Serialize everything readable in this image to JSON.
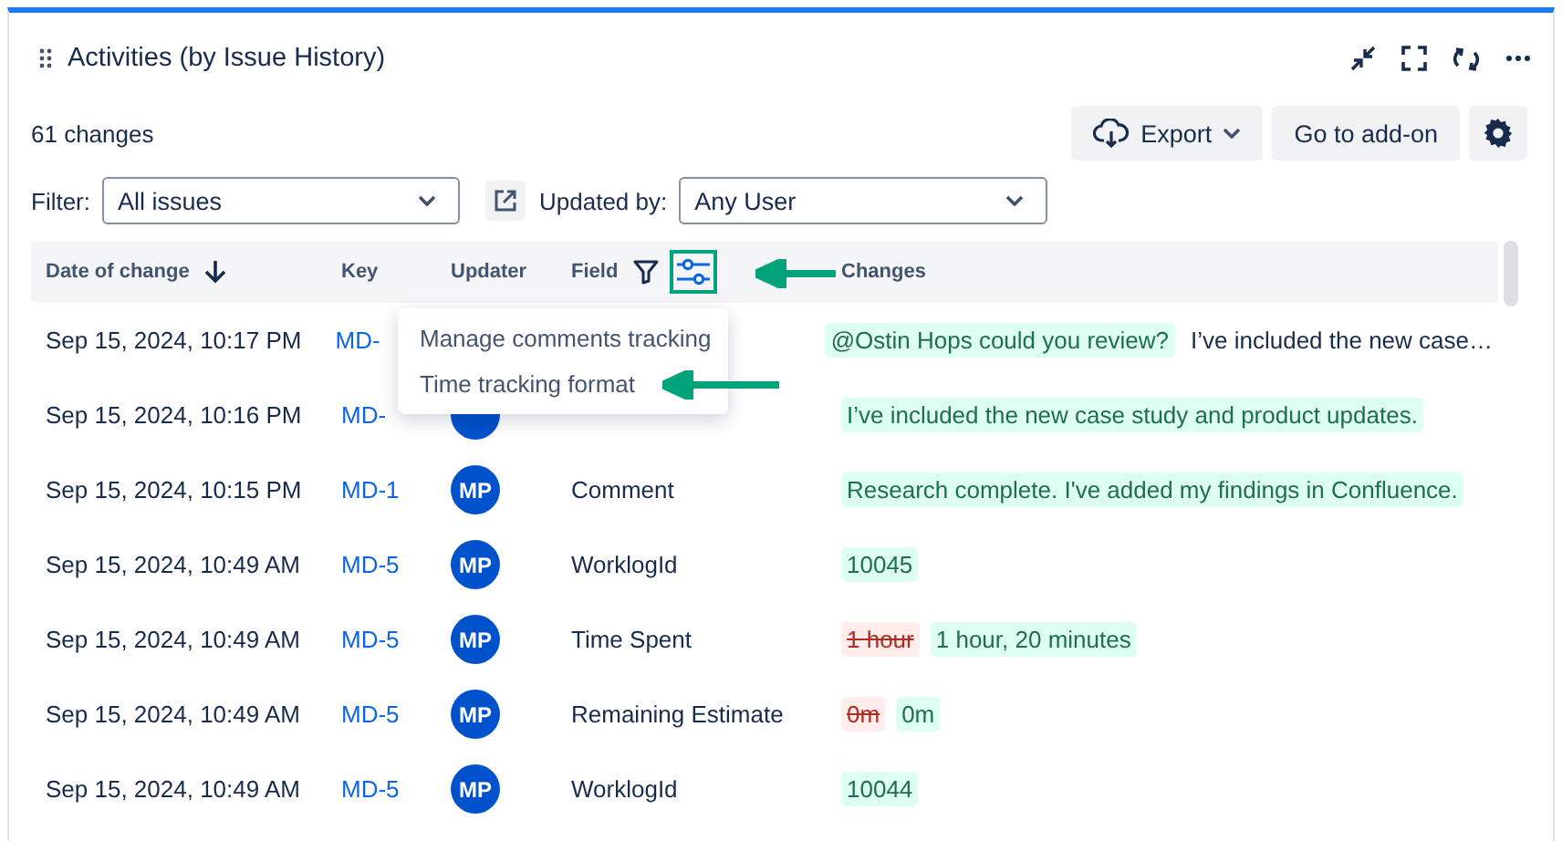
{
  "panel": {
    "title": "Activities (by Issue History)"
  },
  "summary": "61 changes",
  "toolbar": {
    "export": "Export",
    "add_on": "Go to add-on"
  },
  "filters": {
    "filter_label": "Filter:",
    "filter_value": "All issues",
    "updated_by_label": "Updated by:",
    "updated_by_value": "Any User"
  },
  "table": {
    "columns": [
      {
        "label": "Date of change",
        "sorted": true
      },
      {
        "label": "Key"
      },
      {
        "label": "Updater"
      },
      {
        "label": "Field",
        "filter": true
      },
      {
        "label": "Changes"
      }
    ],
    "rows": [
      {
        "date": "Sep 15, 2024, 10:17 PM",
        "key": "MD-",
        "changes": [
          {
            "kind": "added",
            "text": "@Ostin Hops could you review?"
          },
          {
            "kind": "plain",
            "text": "I’ve included the new case…"
          }
        ]
      },
      {
        "date": "Sep 15, 2024, 10:16 PM",
        "key": "MD-",
        "avatar": true,
        "changes": [
          {
            "kind": "added",
            "text": "I’ve included the new case study and product updates."
          }
        ]
      },
      {
        "date": "Sep 15, 2024, 10:15 PM",
        "key": "MD-1",
        "avatar": true,
        "initials": "MP",
        "field": "Comment",
        "changes": [
          {
            "kind": "added",
            "text": "Research complete. I've added my findings in Confluence."
          }
        ]
      },
      {
        "date": "Sep 15, 2024, 10:49 AM",
        "key": "MD-5",
        "avatar": true,
        "initials": "MP",
        "field": "WorklogId",
        "changes": [
          {
            "kind": "added",
            "text": "10045"
          }
        ]
      },
      {
        "date": "Sep 15, 2024, 10:49 AM",
        "key": "MD-5",
        "avatar": true,
        "initials": "MP",
        "field": "Time Spent",
        "changes": [
          {
            "kind": "removed",
            "text": "1 hour"
          },
          {
            "kind": "added",
            "text": "1 hour, 20 minutes"
          }
        ]
      },
      {
        "date": "Sep 15, 2024, 10:49 AM",
        "key": "MD-5",
        "avatar": true,
        "initials": "MP",
        "field": "Remaining Estimate",
        "changes": [
          {
            "kind": "removed",
            "text": "0m"
          },
          {
            "kind": "added",
            "text": "0m"
          }
        ]
      },
      {
        "date": "Sep 15, 2024, 10:49 AM",
        "key": "MD-5",
        "avatar": true,
        "initials": "MP",
        "field": "WorklogId",
        "changes": [
          {
            "kind": "added",
            "text": "10044"
          }
        ]
      }
    ]
  },
  "menu": {
    "items": [
      {
        "label": "Manage comments tracking"
      },
      {
        "label": "Time tracking format"
      }
    ]
  }
}
